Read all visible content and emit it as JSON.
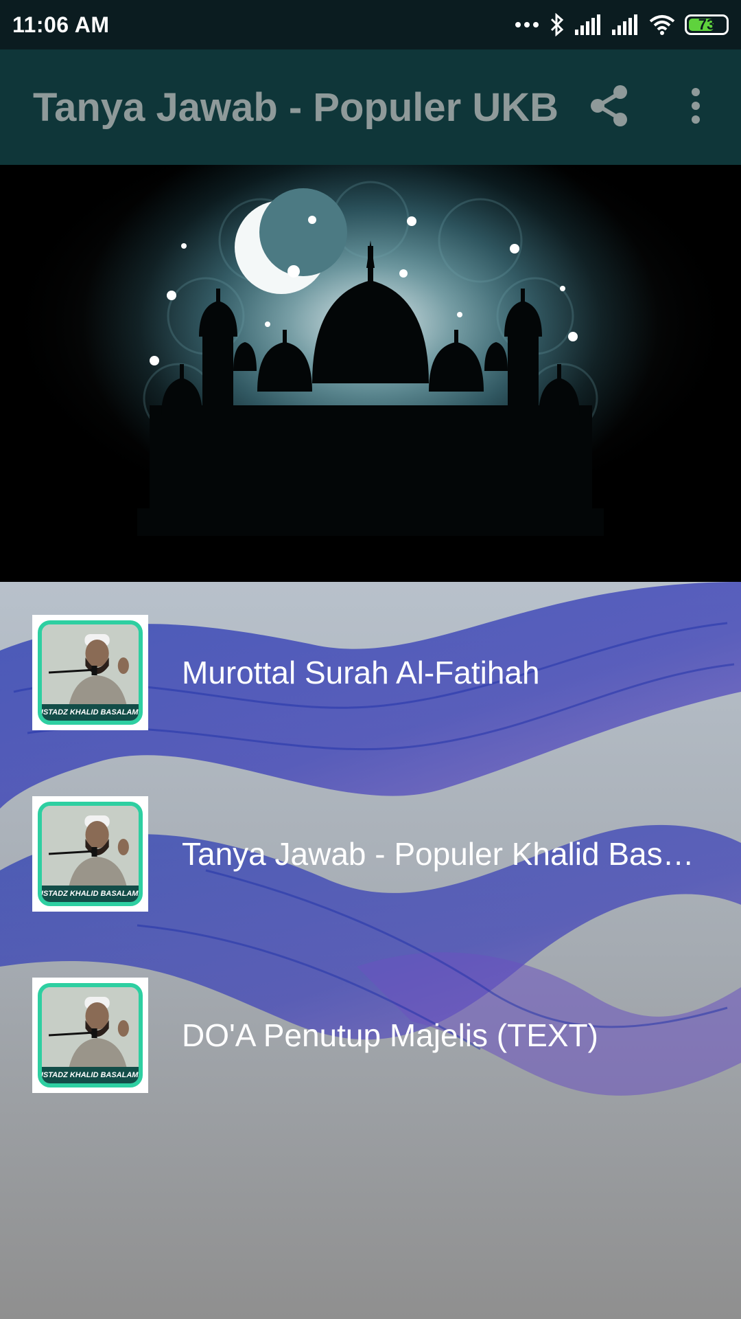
{
  "status_bar": {
    "time": "11:06 AM",
    "battery_level": "73",
    "battery_fraction": 0.73,
    "icons": [
      "more-dots-icon",
      "bluetooth-icon",
      "signal-icon",
      "signal-icon",
      "wifi-icon",
      "battery-icon"
    ]
  },
  "app_bar": {
    "title": "Tanya Jawab - Populer UKB",
    "actions": [
      "share-icon",
      "more-vert-icon"
    ]
  },
  "banner": {
    "image": "mosque-night-crescent-image"
  },
  "list": {
    "items": [
      {
        "label": "Murottal Surah Al-Fatihah",
        "thumb_caption": "USTADZ KHALID BASALAMAH"
      },
      {
        "label": "Tanya Jawab - Populer Khalid Basalamah",
        "thumb_caption": "USTADZ KHALID BASALAMAH"
      },
      {
        "label": "DO'A Penutup Majelis (TEXT)",
        "thumb_caption": "USTADZ KHALID BASALAMAH"
      }
    ]
  },
  "colors": {
    "status_bar": "#0b1c20",
    "app_bar": "#0f3639",
    "title_text": "#8f9a9a",
    "accent_ink": "#2b3fb0",
    "battery": "#5fd23d"
  }
}
